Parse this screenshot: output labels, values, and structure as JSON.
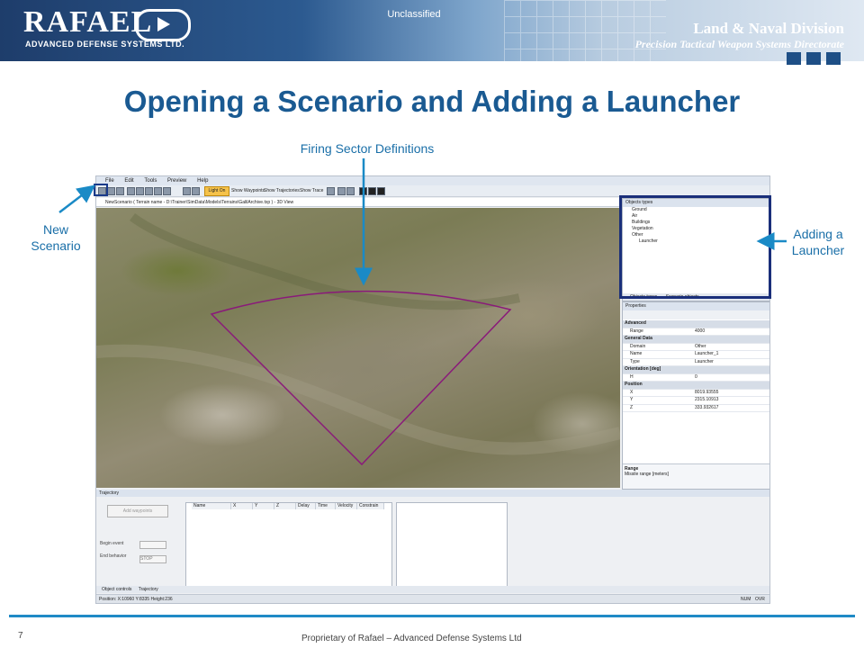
{
  "header": {
    "logo_text": "RAFAEL",
    "logo_subtitle": "ADVANCED DEFENSE SYSTEMS LTD.",
    "classification": "Unclassified",
    "division": "Land & Naval Division",
    "directorate": "Precision Tactical Weapon Systems Directorate"
  },
  "slide": {
    "title": "Opening a Scenario and Adding a Launcher",
    "page_number": "7",
    "footer": "Proprietary of Rafael – Advanced Defense Systems Ltd"
  },
  "callouts": {
    "firing_sector": "Firing Sector Definitions",
    "new_scenario_line1": "New",
    "new_scenario_line2": "Scenario",
    "adding_launcher_line1": "Adding a",
    "adding_launcher_line2": "Launcher"
  },
  "app": {
    "menu": [
      "File",
      "Edit",
      "Tools",
      "Preview",
      "Help"
    ],
    "toolbar": {
      "light_on": "Light On",
      "show_waypoints": "Show Waypoints",
      "show_trajectories": "Show Trajectories",
      "show_trace": "Show Trace"
    },
    "doc_tab": "NewScenario ( Terrain name - D:\\Trainer\\SimData\\Models\\Terrains\\GalilArchive.txp ) - 3D View",
    "object_types": {
      "title": "Objects types",
      "items": [
        "Ground",
        "Air",
        "Buildings",
        "Vegetation",
        "Other",
        "Launcher"
      ],
      "tabs": [
        "Objects types",
        "Scenario objects"
      ]
    },
    "properties": {
      "title": "Properties",
      "rows": [
        {
          "cat": true,
          "k": "Advanced",
          "v": ""
        },
        {
          "cat": false,
          "k": "Range",
          "v": "4000"
        },
        {
          "cat": true,
          "k": "General Data",
          "v": ""
        },
        {
          "cat": false,
          "k": "Domain",
          "v": "Other"
        },
        {
          "cat": false,
          "k": "Name",
          "v": "Launcher_1"
        },
        {
          "cat": false,
          "k": "Type",
          "v": "Launcher"
        },
        {
          "cat": true,
          "k": "Orientation [deg]",
          "v": ""
        },
        {
          "cat": false,
          "k": "H",
          "v": "0"
        },
        {
          "cat": true,
          "k": "Position",
          "v": ""
        },
        {
          "cat": false,
          "k": "X",
          "v": "8019.93555"
        },
        {
          "cat": false,
          "k": "Y",
          "v": "2315.10913"
        },
        {
          "cat": false,
          "k": "Z",
          "v": "333.932617"
        }
      ],
      "desc_title": "Range",
      "desc_text": "Missile range [meters]"
    },
    "trajectory": {
      "title": "Trajectory",
      "add_waypoints": "Add waypoints",
      "begin_event": "Begin event",
      "end_behavior": "End behavior",
      "end_behavior_value": "STOP",
      "columns": [
        "Name",
        "X",
        "Y",
        "Z",
        "Delay",
        "Time",
        "Velocity",
        "Constrain"
      ]
    },
    "bottom_tabs": [
      "Object controls",
      "Trajectory"
    ],
    "status": "Position: X:10960 Y:8335 Height:236",
    "status_right": [
      "NUM",
      "OVR"
    ]
  },
  "colors": {
    "title": "#1a5a92",
    "callout": "#1a6fa8",
    "sector_outline": "#8a1a7a",
    "highlight_box": "#1a2f7a"
  }
}
